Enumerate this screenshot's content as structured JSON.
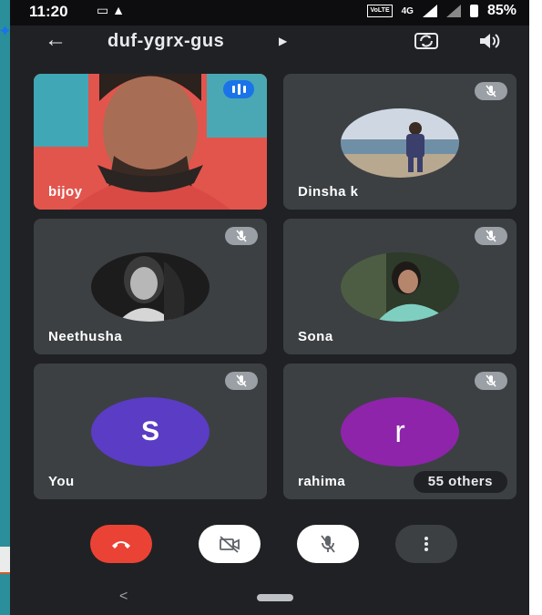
{
  "status_bar": {
    "time": "11:20",
    "network": "4G",
    "volte": "VoLTE",
    "battery": "85%"
  },
  "app_bar": {
    "meeting_code": "duf-ygrx-gus"
  },
  "participants": [
    {
      "name": "bijoy",
      "type": "video",
      "speaking": true
    },
    {
      "name": "Dinsha k",
      "type": "photo",
      "muted": true
    },
    {
      "name": "Neethusha",
      "type": "photo",
      "muted": true
    },
    {
      "name": "Sona",
      "type": "photo",
      "muted": true
    },
    {
      "name": "You",
      "type": "letter",
      "letter": "S",
      "color": "#5b3cc4",
      "muted": true
    },
    {
      "name": "rahima",
      "type": "letter",
      "letter": "r",
      "color": "#8e24aa",
      "muted": true
    }
  ],
  "others_chip": "55 others",
  "controls": {
    "end_call": "end-call-icon",
    "camera": "camera-off-icon",
    "mic": "mic-off-icon",
    "more": "more-vertical-icon"
  },
  "colors": {
    "background": "#202124",
    "tile": "#3c4043",
    "end_call": "#ea4335",
    "speaking": "#1a73e8"
  }
}
